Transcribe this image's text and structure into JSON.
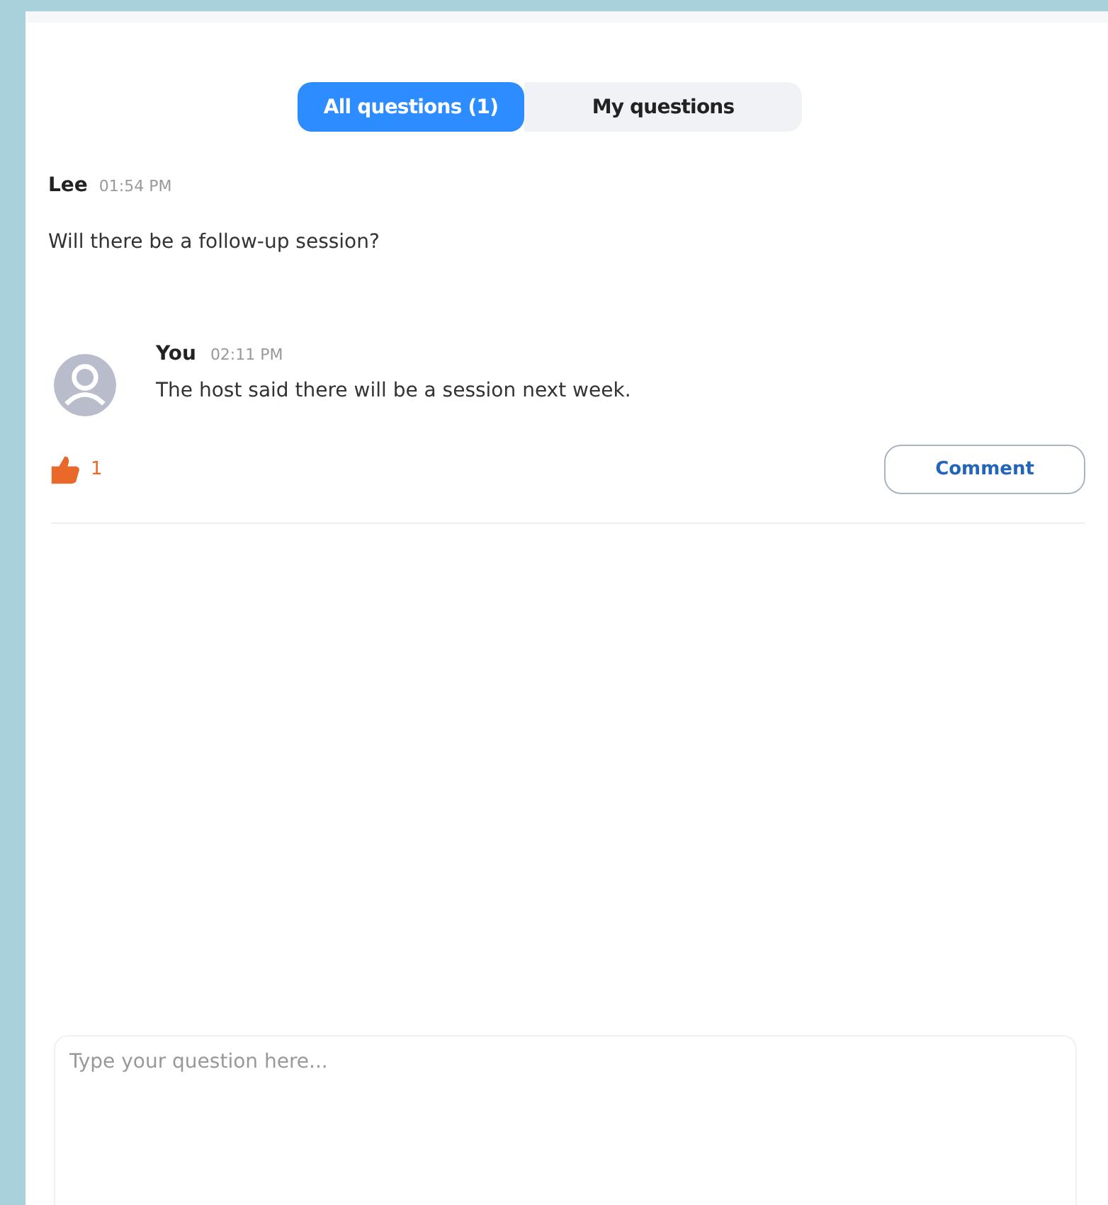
{
  "tabs": [
    {
      "label": "All questions  (1)",
      "selected": true
    },
    {
      "label": "My questions",
      "selected": false
    }
  ],
  "question": {
    "author": "Lee",
    "time": "01:54 PM",
    "text": "Will there be a follow-up session?"
  },
  "answers": [
    {
      "author": "You",
      "time": "02:11 PM",
      "text": "The host said there will be a session next week."
    }
  ],
  "likes": {
    "count": "1",
    "liked": true
  },
  "comment_button": "Comment",
  "input": {
    "placeholder": "Type your question here..."
  }
}
